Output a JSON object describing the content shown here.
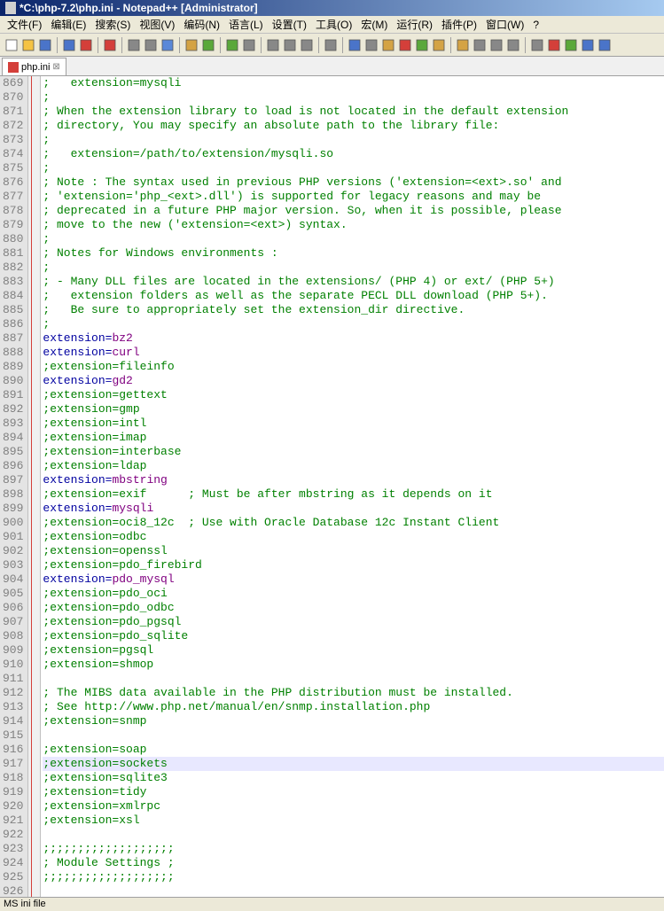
{
  "titleBar": "*C:\\php-7.2\\php.ini - Notepad++ [Administrator]",
  "menu": {
    "items": [
      "文件(F)",
      "编辑(E)",
      "搜索(S)",
      "视图(V)",
      "编码(N)",
      "语言(L)",
      "设置(T)",
      "工具(O)",
      "宏(M)",
      "运行(R)",
      "插件(P)",
      "窗口(W)",
      "?"
    ]
  },
  "tab": {
    "label": "php.ini"
  },
  "startLine": 869,
  "highlightLine": 917,
  "lines": [
    {
      "text": ";   extension=mysqli",
      "type": "comment"
    },
    {
      "text": ";",
      "type": "comment"
    },
    {
      "text": "; When the extension library to load is not located in the default extension",
      "type": "comment"
    },
    {
      "text": "; directory, You may specify an absolute path to the library file:",
      "type": "comment"
    },
    {
      "text": ";",
      "type": "comment"
    },
    {
      "text": ";   extension=/path/to/extension/mysqli.so",
      "type": "comment"
    },
    {
      "text": ";",
      "type": "comment"
    },
    {
      "text": "; Note : The syntax used in previous PHP versions ('extension=<ext>.so' and",
      "type": "comment"
    },
    {
      "text": "; 'extension='php_<ext>.dll') is supported for legacy reasons and may be",
      "type": "comment"
    },
    {
      "text": "; deprecated in a future PHP major version. So, when it is possible, please",
      "type": "comment"
    },
    {
      "text": "; move to the new ('extension=<ext>) syntax.",
      "type": "comment"
    },
    {
      "text": ";",
      "type": "comment"
    },
    {
      "text": "; Notes for Windows environments :",
      "type": "comment"
    },
    {
      "text": ";",
      "type": "comment"
    },
    {
      "text": "; - Many DLL files are located in the extensions/ (PHP 4) or ext/ (PHP 5+)",
      "type": "comment"
    },
    {
      "text": ";   extension folders as well as the separate PECL DLL download (PHP 5+).",
      "type": "comment"
    },
    {
      "text": ";   Be sure to appropriately set the extension_dir directive.",
      "type": "comment"
    },
    {
      "text": ";",
      "type": "comment"
    },
    {
      "k": "extension",
      "v": "bz2",
      "type": "kv"
    },
    {
      "k": "extension",
      "v": "curl",
      "type": "kv"
    },
    {
      "text": ";extension=fileinfo",
      "type": "comment"
    },
    {
      "k": "extension",
      "v": "gd2",
      "type": "kv"
    },
    {
      "text": ";extension=gettext",
      "type": "comment"
    },
    {
      "text": ";extension=gmp",
      "type": "comment"
    },
    {
      "text": ";extension=intl",
      "type": "comment"
    },
    {
      "text": ";extension=imap",
      "type": "comment"
    },
    {
      "text": ";extension=interbase",
      "type": "comment"
    },
    {
      "text": ";extension=ldap",
      "type": "comment"
    },
    {
      "k": "extension",
      "v": "mbstring",
      "type": "kv"
    },
    {
      "text": ";extension=exif      ; Must be after mbstring as it depends on it",
      "type": "comment"
    },
    {
      "k": "extension",
      "v": "mysqli",
      "type": "kv"
    },
    {
      "text": ";extension=oci8_12c  ; Use with Oracle Database 12c Instant Client",
      "type": "comment"
    },
    {
      "text": ";extension=odbc",
      "type": "comment"
    },
    {
      "text": ";extension=openssl",
      "type": "comment"
    },
    {
      "text": ";extension=pdo_firebird",
      "type": "comment"
    },
    {
      "k": "extension",
      "v": "pdo_mysql",
      "type": "kv"
    },
    {
      "text": ";extension=pdo_oci",
      "type": "comment"
    },
    {
      "text": ";extension=pdo_odbc",
      "type": "comment"
    },
    {
      "text": ";extension=pdo_pgsql",
      "type": "comment"
    },
    {
      "text": ";extension=pdo_sqlite",
      "type": "comment"
    },
    {
      "text": ";extension=pgsql",
      "type": "comment"
    },
    {
      "text": ";extension=shmop",
      "type": "comment"
    },
    {
      "text": "",
      "type": "blank"
    },
    {
      "text": "; The MIBS data available in the PHP distribution must be installed.",
      "type": "comment"
    },
    {
      "text": "; See http://www.php.net/manual/en/snmp.installation.php",
      "type": "comment"
    },
    {
      "text": ";extension=snmp",
      "type": "comment"
    },
    {
      "text": "",
      "type": "blank"
    },
    {
      "text": ";extension=soap",
      "type": "comment"
    },
    {
      "text": ";extension=sockets",
      "type": "comment"
    },
    {
      "text": ";extension=sqlite3",
      "type": "comment"
    },
    {
      "text": ";extension=tidy",
      "type": "comment"
    },
    {
      "text": ";extension=xmlrpc",
      "type": "comment"
    },
    {
      "text": ";extension=xsl",
      "type": "comment"
    },
    {
      "text": "",
      "type": "blank"
    },
    {
      "text": ";;;;;;;;;;;;;;;;;;;",
      "type": "comment"
    },
    {
      "text": "; Module Settings ;",
      "type": "comment"
    },
    {
      "text": ";;;;;;;;;;;;;;;;;;;",
      "type": "comment"
    },
    {
      "text": "",
      "type": "blank"
    }
  ],
  "status": "MS ini file",
  "toolbarIcons": [
    "new",
    "open",
    "save",
    "save-all",
    "close",
    "close-all",
    "print",
    "cut",
    "copy",
    "paste",
    "undo",
    "redo",
    "find",
    "replace",
    "zoom-in",
    "zoom-out",
    "sync",
    "word-wrap",
    "whitespace",
    "indent-guide",
    "lang",
    "folding",
    "comments",
    "uncomments",
    "func-list",
    "folder",
    "doc-map",
    "monitor",
    "record",
    "play",
    "stop",
    "playback"
  ]
}
